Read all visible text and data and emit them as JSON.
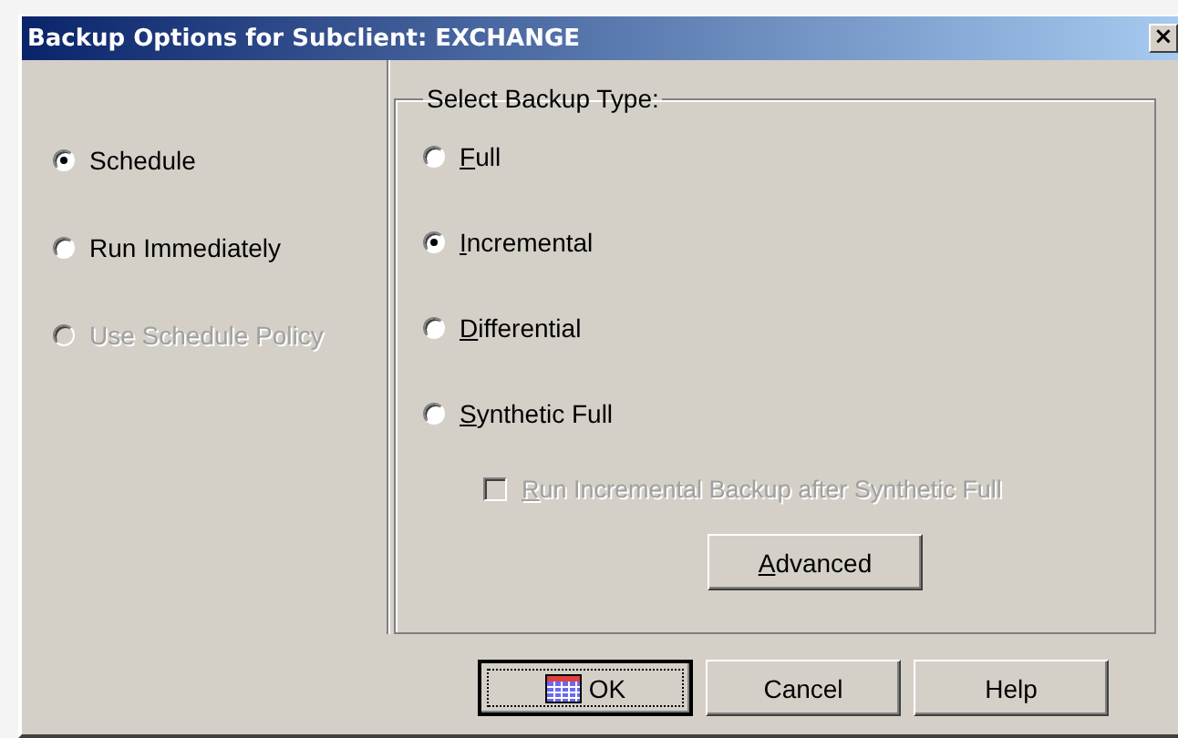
{
  "window": {
    "title": "Backup Options for Subclient: EXCHANGE",
    "close": "×"
  },
  "job_options": [
    {
      "label": "Schedule",
      "selected": true,
      "disabled": false
    },
    {
      "label": "Run Immediately",
      "selected": false,
      "disabled": false
    },
    {
      "label": "Use Schedule Policy",
      "selected": false,
      "disabled": true
    }
  ],
  "backup_type": {
    "title": "Select Backup Type:",
    "options": [
      {
        "label": "Full",
        "selected": false,
        "mnemonic": true
      },
      {
        "label": "Incremental",
        "selected": true,
        "mnemonic": true
      },
      {
        "label": "Differential",
        "selected": false,
        "mnemonic": true
      },
      {
        "label": "Synthetic Full",
        "selected": false,
        "mnemonic": true
      }
    ],
    "run_incremental": {
      "label": "Run Incremental Backup after Synthetic Full",
      "checked": false,
      "disabled": true,
      "mnemonic": true
    },
    "advanced_button": {
      "label": "Advanced",
      "mnemonic": true
    }
  },
  "buttons": [
    {
      "label": "OK",
      "kind": "default"
    },
    {
      "label": "Cancel",
      "kind": "plain"
    },
    {
      "label": "Help",
      "kind": "plain"
    }
  ]
}
